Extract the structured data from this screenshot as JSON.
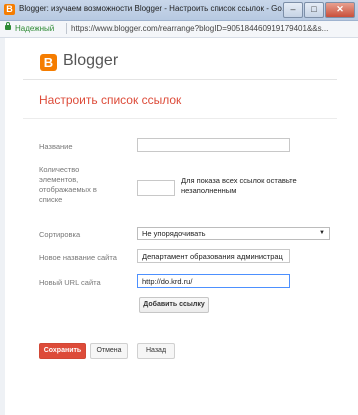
{
  "window": {
    "app_icon_letter": "B",
    "title": "Blogger: изучаем возможности Blogger - Настроить список ссылок - Google Ch...",
    "minimize": "–",
    "maximize": "□",
    "close": "✕"
  },
  "address_bar": {
    "secure_label": "Надежный",
    "url": "https://www.blogger.com/rearrange?blogID=905184460919179401&&s..."
  },
  "header": {
    "logo_letter": "B",
    "brand": "Blogger"
  },
  "page": {
    "title": "Настроить список ссылок"
  },
  "form": {
    "name_label": "Название",
    "name_value": "",
    "count_label": "Количество элементов, отображаемых в списке",
    "count_value": "",
    "count_hint": "Для показа всех ссылок оставьте незаполненным",
    "sort_label": "Сортировка",
    "sort_value": "Не упорядочивать",
    "new_site_name_label": "Новое название сайта",
    "new_site_name_value": "Департамент образования администрац",
    "new_url_label": "Новый URL сайта",
    "new_url_value": "http://do.krd.ru/",
    "add_link_button": "Добавить ссылку"
  },
  "actions": {
    "save": "Сохранить",
    "cancel": "Отмена",
    "back": "Назад"
  },
  "colors": {
    "accent": "#dd4b39",
    "brand": "#f57d00"
  }
}
